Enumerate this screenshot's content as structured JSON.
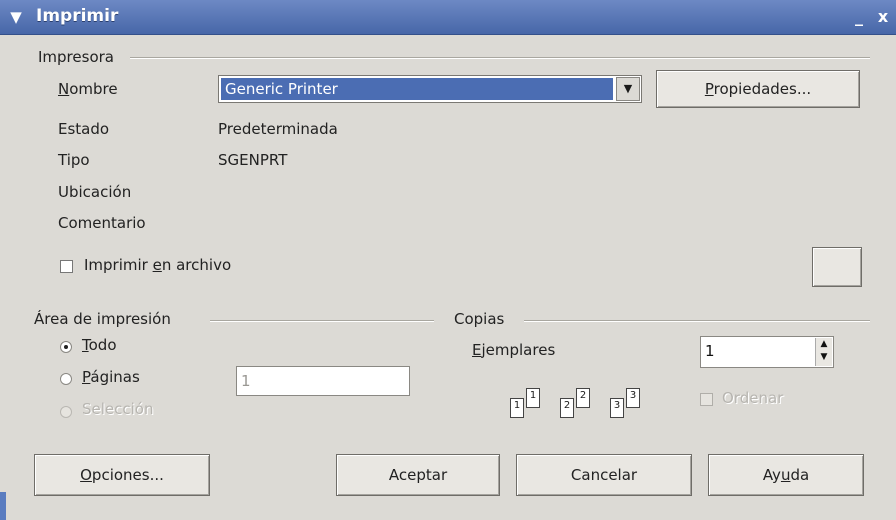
{
  "window": {
    "title": "Imprimir",
    "minimize": "_",
    "close": "x"
  },
  "printer": {
    "group_label": "Impresora",
    "name_label": "Nombre",
    "name_value": "Generic Printer",
    "properties_button": "Propiedades...",
    "state_label": "Estado",
    "state_value": "Predeterminada",
    "type_label": "Tipo",
    "type_value": "SGENPRT",
    "location_label": "Ubicación",
    "comment_label": "Comentario",
    "print_to_file_label": "Imprimir en archivo"
  },
  "print_area": {
    "group_label": "Área de impresión",
    "all_label": "Todo",
    "pages_label": "Páginas",
    "pages_placeholder": "1",
    "selection_label": "Selección"
  },
  "copies": {
    "group_label": "Copias",
    "copies_label": "Ejemplares",
    "copies_value": "1",
    "collate_label": "Ordenar",
    "pages": [
      "1",
      "1",
      "2",
      "2",
      "3",
      "3"
    ]
  },
  "buttons": {
    "options": "Opciones...",
    "ok": "Aceptar",
    "cancel": "Cancelar",
    "help": "Ayuda"
  }
}
